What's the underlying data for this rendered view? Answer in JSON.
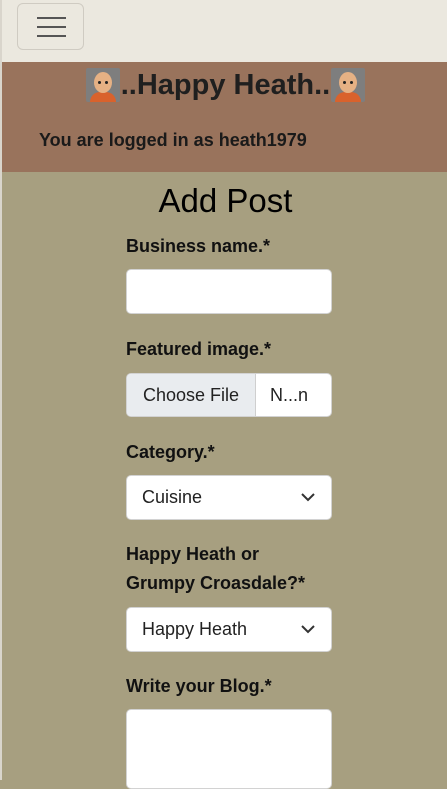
{
  "navbar": {
    "menu_icon": "hamburger-icon"
  },
  "header": {
    "brand_title": "..Happy Heath..",
    "avatar_icon": "avatar-icon",
    "login_status": "You are logged in as heath1979"
  },
  "form": {
    "title": "Add Post",
    "business_label": "Business name.*",
    "business_value": "",
    "image_label": "Featured image.*",
    "file_button": "Choose File",
    "file_name": "N...n",
    "category_label": "Category.*",
    "category_value": "Cuisine",
    "mood_label_line1": "Happy Heath or",
    "mood_label_line2": "Grumpy Croasdale?*",
    "mood_value": "Happy Heath",
    "blog_label": "Write your Blog.*",
    "blog_value": ""
  },
  "colors": {
    "page_bg": "#a79f80",
    "header_bg": "#99735c",
    "navbar_bg": "#ebe8df"
  }
}
